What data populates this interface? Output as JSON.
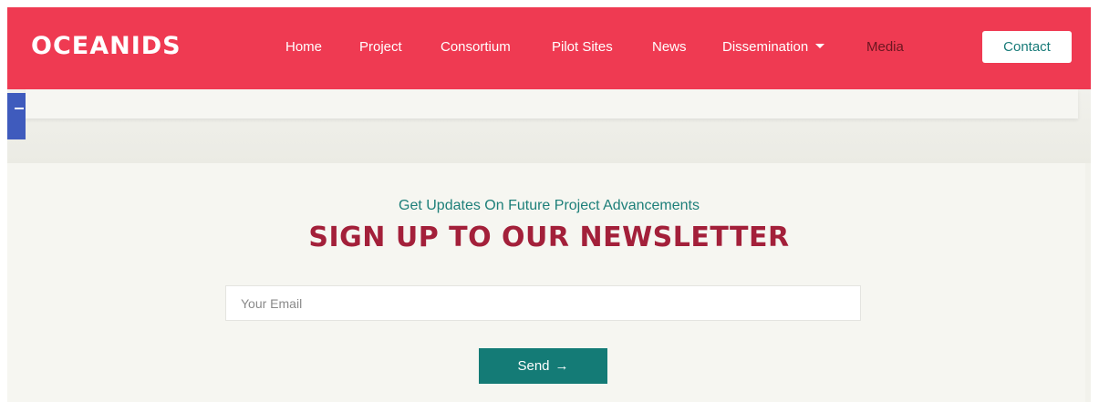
{
  "brand": {
    "logo_text": "OCEANIDS"
  },
  "nav": {
    "items": [
      {
        "label": "Home"
      },
      {
        "label": "Project"
      },
      {
        "label": "Consortium"
      },
      {
        "label": "Pilot Sites"
      },
      {
        "label": "News"
      },
      {
        "label": "Dissemination"
      },
      {
        "label": "Media"
      }
    ],
    "contact_label": "Contact"
  },
  "newsletter": {
    "subtitle": "Get Updates On Future Project Advancements",
    "title": "SIGN UP TO OUR NEWSLETTER",
    "email_placeholder": "Your Email",
    "send_label": "Send",
    "send_arrow": "→"
  },
  "icons": {
    "dropdown": "caret-down-icon",
    "send": "arrow-right-icon",
    "side_tab": "side-tab-icon"
  },
  "colors": {
    "header_bg": "#ef3a52",
    "active_nav": "#6b1620",
    "accent_teal": "#147b76",
    "title": "#a3203a",
    "side_tab": "#3f5bbd"
  }
}
